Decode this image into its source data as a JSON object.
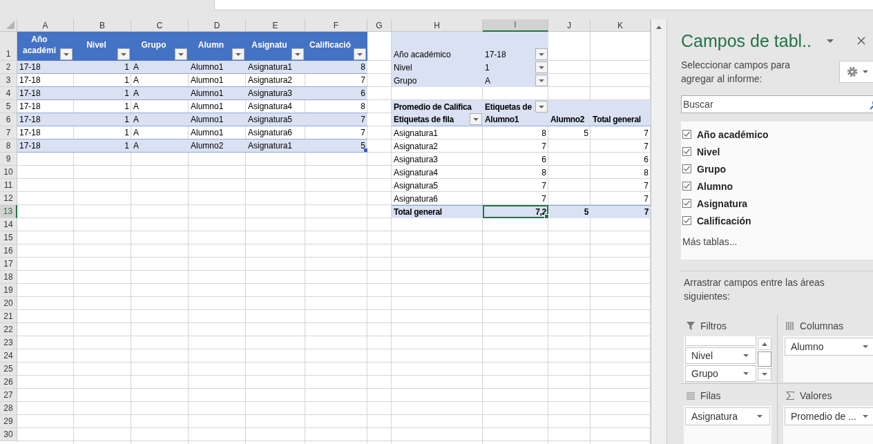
{
  "sheet": {
    "column_headers": [
      {
        "label": "A",
        "selected": false
      },
      {
        "label": "B",
        "selected": false
      },
      {
        "label": "C",
        "selected": false
      },
      {
        "label": "D",
        "selected": false
      },
      {
        "label": "E",
        "selected": false
      },
      {
        "label": "F",
        "selected": false
      },
      {
        "label": "G",
        "selected": false
      },
      {
        "label": "H",
        "selected": false
      },
      {
        "label": "I",
        "selected": true
      },
      {
        "label": "J",
        "selected": false
      },
      {
        "label": "K",
        "selected": false
      }
    ],
    "row_headers": [
      {
        "label": "1",
        "selected": false
      },
      {
        "label": "2",
        "selected": false
      },
      {
        "label": "3",
        "selected": false
      },
      {
        "label": "4",
        "selected": false
      },
      {
        "label": "5",
        "selected": false
      },
      {
        "label": "6",
        "selected": false
      },
      {
        "label": "7",
        "selected": false
      },
      {
        "label": "8",
        "selected": false
      },
      {
        "label": "9",
        "selected": false
      },
      {
        "label": "10",
        "selected": false
      },
      {
        "label": "11",
        "selected": false
      },
      {
        "label": "12",
        "selected": false
      },
      {
        "label": "13",
        "selected": true
      },
      {
        "label": "14",
        "selected": false
      },
      {
        "label": "15",
        "selected": false
      },
      {
        "label": "16",
        "selected": false
      },
      {
        "label": "17",
        "selected": false
      },
      {
        "label": "18",
        "selected": false
      },
      {
        "label": "19",
        "selected": false
      },
      {
        "label": "20",
        "selected": false
      },
      {
        "label": "21",
        "selected": false
      },
      {
        "label": "22",
        "selected": false
      },
      {
        "label": "23",
        "selected": false
      },
      {
        "label": "24",
        "selected": false
      },
      {
        "label": "25",
        "selected": false
      },
      {
        "label": "26",
        "selected": false
      },
      {
        "label": "27",
        "selected": false
      },
      {
        "label": "28",
        "selected": false
      },
      {
        "label": "29",
        "selected": false
      },
      {
        "label": "30",
        "selected": false
      }
    ]
  },
  "source_table": {
    "columns": [
      {
        "label": "Año académi",
        "kind": "text"
      },
      {
        "label": "Nivel",
        "kind": "number"
      },
      {
        "label": "Grupo",
        "kind": "text"
      },
      {
        "label": "Alumn",
        "kind": "text"
      },
      {
        "label": "Asignatu",
        "kind": "text"
      },
      {
        "label": "Calificació",
        "kind": "number"
      }
    ],
    "rows": [
      [
        "17-18",
        "1",
        "A",
        "Alumno1",
        "Asignatura1",
        "8"
      ],
      [
        "17-18",
        "1",
        "A",
        "Alumno1",
        "Asignatura2",
        "7"
      ],
      [
        "17-18",
        "1",
        "A",
        "Alumno1",
        "Asignatura3",
        "6"
      ],
      [
        "17-18",
        "1",
        "A",
        "Alumno1",
        "Asignatura4",
        "8"
      ],
      [
        "17-18",
        "1",
        "A",
        "Alumno1",
        "Asignatura5",
        "7"
      ],
      [
        "17-18",
        "1",
        "A",
        "Alumno1",
        "Asignatura6",
        "7"
      ],
      [
        "17-18",
        "1",
        "A",
        "Alumno2",
        "Asignatura1",
        "5"
      ]
    ]
  },
  "pivot": {
    "filters": [
      {
        "label": "Año académico",
        "value": "17-18"
      },
      {
        "label": "Nivel",
        "value": "1"
      },
      {
        "label": "Grupo",
        "value": "A"
      }
    ],
    "values_header": "Promedio de Califica",
    "column_labels_header": "Etiquetas de",
    "row_labels_header": "Etiquetas de fila",
    "columns": [
      "Alumno1",
      "Alumno2",
      "Total general"
    ],
    "rows": [
      {
        "label": "Asignatura1",
        "values": {
          "col_1": "8",
          "col_2": "5",
          "col_3": "7"
        }
      },
      {
        "label": "Asignatura2",
        "values": {
          "col_1": "7",
          "col_3": "7"
        }
      },
      {
        "label": "Asignatura3",
        "values": {
          "col_1": "6",
          "col_3": "6"
        }
      },
      {
        "label": "Asignatura4",
        "values": {
          "col_1": "8",
          "col_3": "8"
        }
      },
      {
        "label": "Asignatura5",
        "values": {
          "col_1": "7",
          "col_3": "7"
        }
      },
      {
        "label": "Asignatura6",
        "values": {
          "col_1": "7",
          "col_3": "7"
        }
      }
    ],
    "total": {
      "label": "Total general",
      "cells": [
        {
          "value": "7,2",
          "selected": true
        },
        {
          "value": "5",
          "selected": false
        },
        {
          "value": "7",
          "selected": false
        }
      ]
    }
  },
  "field_list": {
    "title": "Campos de tabl..",
    "subtitle": "Seleccionar campos para agregar al informe:",
    "search": {
      "placeholder": "Buscar"
    },
    "fields": [
      {
        "label": "Año académico",
        "checked": true
      },
      {
        "label": "Nivel",
        "checked": true
      },
      {
        "label": "Grupo",
        "checked": true
      },
      {
        "label": "Alumno",
        "checked": true
      },
      {
        "label": "Asignatura",
        "checked": true
      },
      {
        "label": "Calificación",
        "checked": true
      }
    ],
    "more_tables": "Más tablas...",
    "drag_hint": "Arrastrar campos entre las áreas siguientes:",
    "areas": [
      {
        "kind": "filters",
        "title": "Filtros",
        "scrolled": true,
        "items": [
          "Nivel",
          "Grupo"
        ]
      },
      {
        "kind": "columns",
        "title": "Columnas",
        "items": [
          "Alumno"
        ]
      },
      {
        "kind": "rows",
        "title": "Filas",
        "items": [
          "Asignatura"
        ]
      },
      {
        "kind": "values",
        "title": "Valores",
        "items": [
          "Promedio de ..."
        ]
      }
    ]
  }
}
